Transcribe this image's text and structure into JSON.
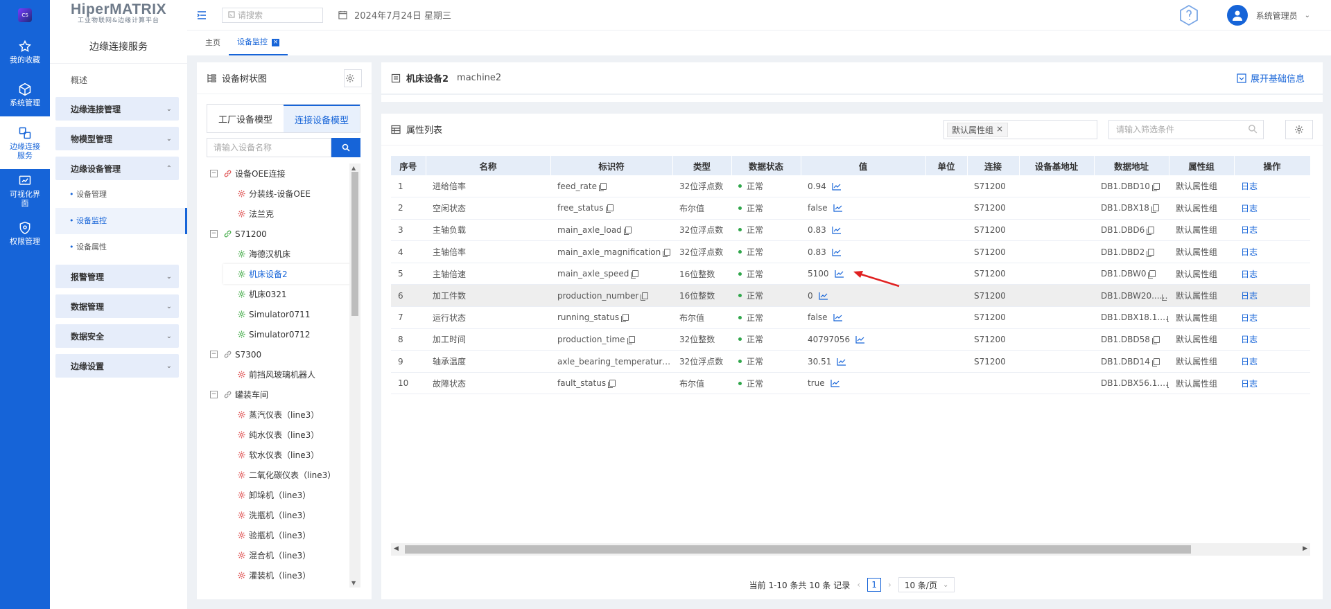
{
  "rail": {
    "logo_text": "CS",
    "items": [
      {
        "label": "我的收藏",
        "icon": "star-icon"
      },
      {
        "label": "系统管理",
        "icon": "cube-icon"
      },
      {
        "label": "边缘连接\n服务",
        "icon": "connect-icon"
      },
      {
        "label": "可视化界\n面",
        "icon": "chart-icon"
      },
      {
        "label": "权限管理",
        "icon": "shield-icon"
      }
    ]
  },
  "brand": {
    "name": "HiperMATRIX",
    "tagline": "工业物联网&边缘计算平台"
  },
  "sidebar": {
    "title": "边缘连接服务",
    "overview": "概述",
    "groups": [
      {
        "label": "边缘连接管理"
      },
      {
        "label": "物模型管理"
      },
      {
        "label": "边缘设备管理"
      },
      {
        "label": "报警管理"
      },
      {
        "label": "数据管理"
      },
      {
        "label": "数据安全"
      },
      {
        "label": "边缘设置"
      }
    ],
    "subitems": [
      "设备管理",
      "设备监控",
      "设备属性"
    ]
  },
  "topbar": {
    "search_placeholder": "请搜索",
    "date": "2024年7月24日 星期三",
    "user": "系统管理员"
  },
  "tabs": [
    {
      "label": "主页"
    },
    {
      "label": "设备监控"
    }
  ],
  "tree": {
    "title": "设备树状图",
    "model_tabs": [
      "工厂设备模型",
      "连接设备模型"
    ],
    "search_placeholder": "请输入设备名称",
    "nodes": [
      {
        "label": "设备OEE连接",
        "level": 1,
        "color": "#e05a5a"
      },
      {
        "label": "分装线-设备OEE",
        "level": 2,
        "color": "#e05a5a"
      },
      {
        "label": "法兰克",
        "level": 2,
        "color": "#e05a5a"
      },
      {
        "label": "S71200",
        "level": 1,
        "color": "#4caf50"
      },
      {
        "label": "海德汉机床",
        "level": 2,
        "color": "#4caf50"
      },
      {
        "label": "机床设备2",
        "level": 2,
        "color": "#4caf50",
        "selected": true
      },
      {
        "label": "机床0321",
        "level": 2,
        "color": "#4caf50"
      },
      {
        "label": "Simulator0711",
        "level": 2,
        "color": "#4caf50"
      },
      {
        "label": "Simulator0712",
        "level": 2,
        "color": "#4caf50"
      },
      {
        "label": "S7300",
        "level": 1,
        "color": "#999999"
      },
      {
        "label": "前挡风玻璃机器人",
        "level": 2,
        "color": "#e05a5a"
      },
      {
        "label": "罐装车间",
        "level": 1,
        "color": "#999999"
      },
      {
        "label": "蒸汽仪表（line3）",
        "level": 2,
        "color": "#e05a5a"
      },
      {
        "label": "纯水仪表（line3）",
        "level": 2,
        "color": "#e05a5a"
      },
      {
        "label": "软水仪表（line3）",
        "level": 2,
        "color": "#e05a5a"
      },
      {
        "label": "二氧化碳仪表（line3）",
        "level": 2,
        "color": "#e05a5a"
      },
      {
        "label": "卸垛机（line3）",
        "level": 2,
        "color": "#e05a5a"
      },
      {
        "label": "洗瓶机（line3）",
        "level": 2,
        "color": "#e05a5a"
      },
      {
        "label": "验瓶机（line3）",
        "level": 2,
        "color": "#e05a5a"
      },
      {
        "label": "混合机（line3）",
        "level": 2,
        "color": "#e05a5a"
      },
      {
        "label": "灌装机（line3）",
        "level": 2,
        "color": "#e05a5a"
      }
    ]
  },
  "device": {
    "name": "机床设备2",
    "code": "machine2",
    "expand_label": "展开基础信息"
  },
  "props": {
    "title": "属性列表",
    "group_chip": "默认属性组",
    "filter_placeholder": "请输入筛选条件",
    "columns": [
      "序号",
      "名称",
      "标识符",
      "类型",
      "数据状态",
      "值",
      "单位",
      "连接",
      "设备基地址",
      "数据地址",
      "属性组",
      "操作"
    ],
    "rows": [
      {
        "no": "1",
        "name": "进给倍率",
        "id": "feed_rate",
        "type": "32位浮点数",
        "status": "正常",
        "value": "0.94",
        "unit": "",
        "conn": "S71200",
        "base": "",
        "addr": "DB1.DBD10",
        "group": "默认属性组",
        "op": "日志"
      },
      {
        "no": "2",
        "name": "空闲状态",
        "id": "free_status",
        "type": "布尔值",
        "status": "正常",
        "value": "false",
        "unit": "",
        "conn": "S71200",
        "base": "",
        "addr": "DB1.DBX18",
        "group": "默认属性组",
        "op": "日志"
      },
      {
        "no": "3",
        "name": "主轴负载",
        "id": "main_axle_load",
        "type": "32位浮点数",
        "status": "正常",
        "value": "0.83",
        "unit": "",
        "conn": "S71200",
        "base": "",
        "addr": "DB1.DBD6",
        "group": "默认属性组",
        "op": "日志"
      },
      {
        "no": "4",
        "name": "主轴倍率",
        "id": "main_axle_magnification",
        "type": "32位浮点数",
        "status": "正常",
        "value": "0.83",
        "unit": "",
        "conn": "S71200",
        "base": "",
        "addr": "DB1.DBD2",
        "group": "默认属性组",
        "op": "日志"
      },
      {
        "no": "5",
        "name": "主轴倍速",
        "id": "main_axle_speed",
        "type": "16位整数",
        "status": "正常",
        "value": "5100",
        "unit": "",
        "conn": "S71200",
        "base": "",
        "addr": "DB1.DBW0",
        "group": "默认属性组",
        "op": "日志"
      },
      {
        "no": "6",
        "name": "加工件数",
        "id": "production_number",
        "type": "16位整数",
        "status": "正常",
        "value": "0",
        "unit": "",
        "conn": "S71200",
        "base": "",
        "addr": "DB1.DBW20...",
        "group": "默认属性组",
        "op": "日志"
      },
      {
        "no": "7",
        "name": "运行状态",
        "id": "running_status",
        "type": "布尔值",
        "status": "正常",
        "value": "false",
        "unit": "",
        "conn": "S71200",
        "base": "",
        "addr": "DB1.DBX18.1...",
        "group": "默认属性组",
        "op": "日志"
      },
      {
        "no": "8",
        "name": "加工时间",
        "id": "production_time",
        "type": "32位整数",
        "status": "正常",
        "value": "40797056",
        "unit": "",
        "conn": "S71200",
        "base": "",
        "addr": "DB1.DBD58",
        "group": "默认属性组",
        "op": "日志"
      },
      {
        "no": "9",
        "name": "轴承温度",
        "id": "axle_bearing_temperature...",
        "type": "32位浮点数",
        "status": "正常",
        "value": "30.51",
        "unit": "",
        "conn": "S71200",
        "base": "",
        "addr": "DB1.DBD14",
        "group": "默认属性组",
        "op": "日志"
      },
      {
        "no": "10",
        "name": "故障状态",
        "id": "fault_status",
        "type": "布尔值",
        "status": "正常",
        "value": "true",
        "unit": "",
        "conn": "",
        "base": "",
        "addr": "DB1.DBX56.1...",
        "group": "默认属性组",
        "op": "日志"
      }
    ],
    "highlight_row": 6
  },
  "pager": {
    "summary": "当前 1-10 条共 10 条 记录",
    "page": "1",
    "size": "10 条/页"
  }
}
